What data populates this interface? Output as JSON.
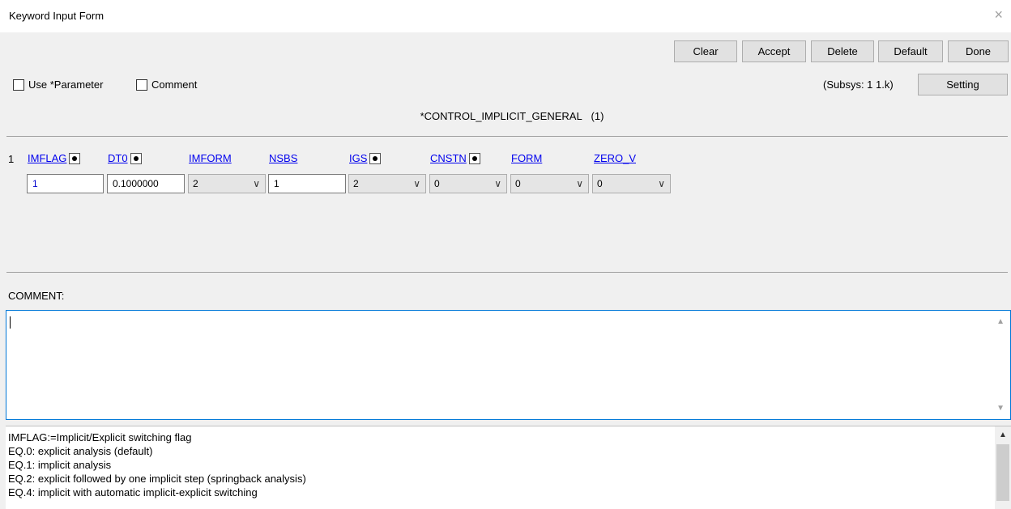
{
  "window": {
    "title": "Keyword Input Form",
    "close_glyph": "×"
  },
  "toolbar": {
    "clear": "Clear",
    "accept": "Accept",
    "delete": "Delete",
    "default": "Default",
    "done": "Done",
    "setting": "Setting"
  },
  "options": {
    "use_parameter": "Use *Parameter",
    "comment": "Comment"
  },
  "subsys": "(Subsys: 1 1.k)",
  "keyword_title": "*CONTROL_IMPLICIT_GENERAL",
  "keyword_count": "(1)",
  "card": {
    "row_number": "1",
    "fields": [
      {
        "name": "IMFLAG",
        "value": "1",
        "kind": "text",
        "dot": true
      },
      {
        "name": "DT0",
        "value": "0.1000000",
        "kind": "text",
        "dot": true
      },
      {
        "name": "IMFORM",
        "value": "2",
        "kind": "select",
        "dot": false
      },
      {
        "name": "NSBS",
        "value": "1",
        "kind": "text",
        "dot": false
      },
      {
        "name": "IGS",
        "value": "2",
        "kind": "select",
        "dot": true
      },
      {
        "name": "CNSTN",
        "value": "0",
        "kind": "select",
        "dot": true
      },
      {
        "name": "FORM",
        "value": "0",
        "kind": "select",
        "dot": false
      },
      {
        "name": "ZERO_V",
        "value": "0",
        "kind": "select",
        "dot": false
      }
    ]
  },
  "comment_label": "COMMENT:",
  "comment_value": "",
  "help_lines": [
    "IMFLAG:=Implicit/Explicit switching flag",
    "EQ.0: explicit analysis (default)",
    "EQ.1: implicit analysis",
    "EQ.2: explicit followed by one implicit step (springback analysis)",
    "EQ.4: implicit with automatic implicit-explicit switching"
  ],
  "icons": {
    "dropdown": "chevron-down-icon",
    "close": "close-icon",
    "scroll_up": "scroll-up-icon",
    "scroll_down": "scroll-down-icon"
  }
}
